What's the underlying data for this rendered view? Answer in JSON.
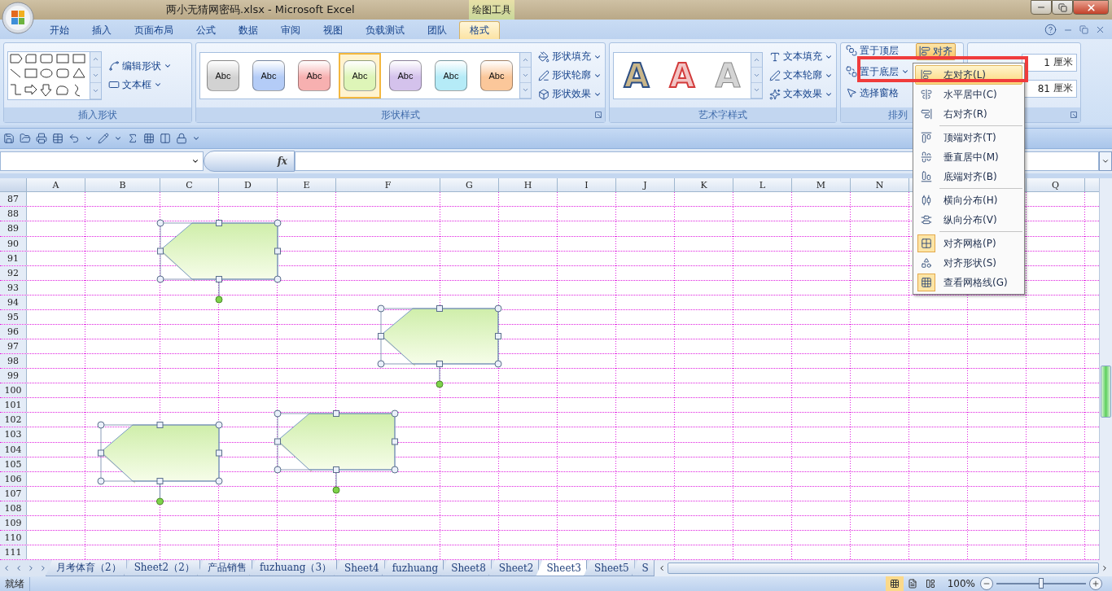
{
  "window": {
    "title": "两小无猜网密码.xlsx - Microsoft Excel",
    "context_label": "绘图工具"
  },
  "ribbon_tabs": [
    {
      "label": "开始",
      "selected": false
    },
    {
      "label": "插入",
      "selected": false
    },
    {
      "label": "页面布局",
      "selected": false
    },
    {
      "label": "公式",
      "selected": false
    },
    {
      "label": "数据",
      "selected": false
    },
    {
      "label": "审阅",
      "selected": false
    },
    {
      "label": "视图",
      "selected": false
    },
    {
      "label": "负载测试",
      "selected": false
    },
    {
      "label": "团队",
      "selected": false
    },
    {
      "label": "格式",
      "selected": true
    }
  ],
  "ribbon": {
    "insert_shapes": {
      "title": "插入形状",
      "buttons": [
        "编辑形状",
        "文本框"
      ]
    },
    "shape_styles": {
      "title": "形状样式",
      "swatches": [
        {
          "label": "Abc",
          "color": "#d2d2d2",
          "selected": false
        },
        {
          "label": "Abc",
          "color": "#b4ccf7",
          "selected": false
        },
        {
          "label": "Abc",
          "color": "#f7b0b0",
          "selected": false
        },
        {
          "label": "Abc",
          "color": "#def5b8",
          "selected": true
        },
        {
          "label": "Abc",
          "color": "#d4c2ec",
          "selected": false
        },
        {
          "label": "Abc",
          "color": "#b5ebf7",
          "selected": false
        },
        {
          "label": "Abc",
          "color": "#fbc79a",
          "selected": false
        }
      ],
      "buttons": [
        "形状填充",
        "形状轮廓",
        "形状效果"
      ]
    },
    "wordart_styles": {
      "title": "艺术字样式",
      "swatches": [
        {
          "label": "A",
          "kind": "outline"
        },
        {
          "label": "A",
          "kind": "red"
        },
        {
          "label": "A",
          "kind": "plain"
        }
      ],
      "buttons": [
        "文本填充",
        "文本轮廓",
        "文本效果"
      ]
    },
    "arrange": {
      "title": "排列",
      "buttons": [
        "置于顶层",
        "置于底层",
        "选择窗格"
      ],
      "align_button": {
        "label": "对齐",
        "pressed": true
      }
    },
    "size": {
      "fields": [
        {
          "value": "1",
          "unit": "厘米"
        },
        {
          "value": "81",
          "unit": "厘米"
        }
      ]
    }
  },
  "formula_bar": {
    "function_label": "fx"
  },
  "columns": [
    {
      "label": "A"
    },
    {
      "label": "B"
    },
    {
      "label": "C"
    },
    {
      "label": "D"
    },
    {
      "label": "E"
    },
    {
      "label": "F"
    },
    {
      "label": "G"
    },
    {
      "label": "H"
    },
    {
      "label": "I"
    },
    {
      "label": "J"
    },
    {
      "label": "K"
    },
    {
      "label": "L"
    },
    {
      "label": "M"
    },
    {
      "label": "N"
    },
    {},
    {},
    {
      "label": "Q"
    }
  ],
  "rows": [
    "87",
    "88",
    "89",
    "90",
    "91",
    "92",
    "93",
    "94",
    "95",
    "96",
    "97",
    "98",
    "99",
    "100",
    "101",
    "102",
    "103",
    "104",
    "105",
    "106",
    "107",
    "108",
    "109",
    "110",
    "111"
  ],
  "shapes": [
    {
      "kind": "pentagon",
      "selected": true
    },
    {
      "kind": "pentagon",
      "selected": true
    },
    {
      "kind": "pentagon",
      "selected": true
    },
    {
      "kind": "pentagon",
      "selected": true
    }
  ],
  "arrange_menu": {
    "items": [
      {
        "kind": "left",
        "label": "左对齐(L)",
        "selected": true,
        "checked": false
      },
      {
        "kind": "center",
        "label": "水平居中(C)",
        "selected": false,
        "checked": false
      },
      {
        "kind": "right",
        "label": "右对齐(R)",
        "selected": false,
        "checked": false
      },
      {
        "kind": "separator"
      },
      {
        "kind": "top",
        "label": "顶端对齐(T)",
        "selected": false,
        "checked": false
      },
      {
        "kind": "middle",
        "label": "垂直居中(M)",
        "selected": false,
        "checked": false
      },
      {
        "kind": "bottom",
        "label": "底端对齐(B)",
        "selected": false,
        "checked": false
      },
      {
        "kind": "separator"
      },
      {
        "kind": "spread",
        "label": "横向分布(H)",
        "selected": false,
        "checked": false
      },
      {
        "kind": "stack",
        "label": "纵向分布(V)",
        "selected": false,
        "checked": false
      },
      {
        "kind": "separator"
      },
      {
        "kind": "snapgrid",
        "label": "对齐网格(P)",
        "selected": false,
        "checked": true
      },
      {
        "kind": "snapshape",
        "label": "对齐形状(S)",
        "selected": false,
        "checked": false
      },
      {
        "kind": "gridlines",
        "label": "查看网格线(G)",
        "selected": false,
        "checked": true
      }
    ]
  },
  "sheet_tabs": [
    {
      "label": "月考体育（2）",
      "selected": false
    },
    {
      "label": "Sheet2（2）",
      "selected": false
    },
    {
      "label": "产品销售",
      "selected": false
    },
    {
      "label": "fuzhuang（3）",
      "selected": false
    },
    {
      "label": "Sheet4",
      "selected": false
    },
    {
      "label": "fuzhuang",
      "selected": false
    },
    {
      "label": "Sheet8",
      "selected": false
    },
    {
      "label": "Sheet2",
      "selected": false
    },
    {
      "label": "Sheet3",
      "selected": true
    },
    {
      "label": "Sheet5",
      "selected": false
    },
    {
      "label": "S",
      "selected": false
    }
  ],
  "status_bar": {
    "ready": "就绪",
    "views": [
      {
        "selected": true
      },
      {
        "selected": false
      },
      {
        "selected": false
      }
    ],
    "zoom": "100%",
    "zoom_slider": {
      "level": 0.5
    }
  }
}
